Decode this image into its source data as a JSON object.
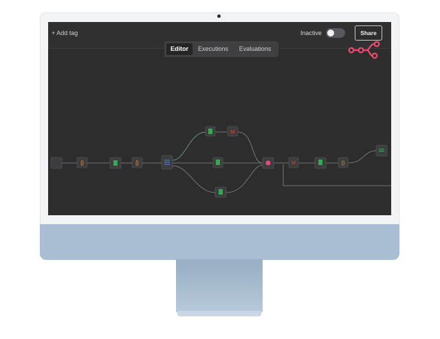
{
  "header": {
    "add_tag_label": "+ Add tag",
    "status_label": "Inactive",
    "share_label": "Share",
    "active_toggle": false
  },
  "tabs": [
    {
      "label": "Editor",
      "active": true
    },
    {
      "label": "Executions",
      "active": false
    },
    {
      "label": "Evaluations",
      "active": false
    }
  ],
  "colors": {
    "canvas_bg": "#2d2d2e",
    "brand": "#ea4b71",
    "node_bg": "#3d3d40",
    "gmail_green": "#34a853",
    "connection_line": "#8a8a8f",
    "monitor_blue": "#a9bed3"
  },
  "icons": {
    "logo": "n8n-logo-icon",
    "code": "curly-braces-icon",
    "gmail": "gmail-icon",
    "switch": "switch-icon",
    "merge": "merge-icon"
  }
}
